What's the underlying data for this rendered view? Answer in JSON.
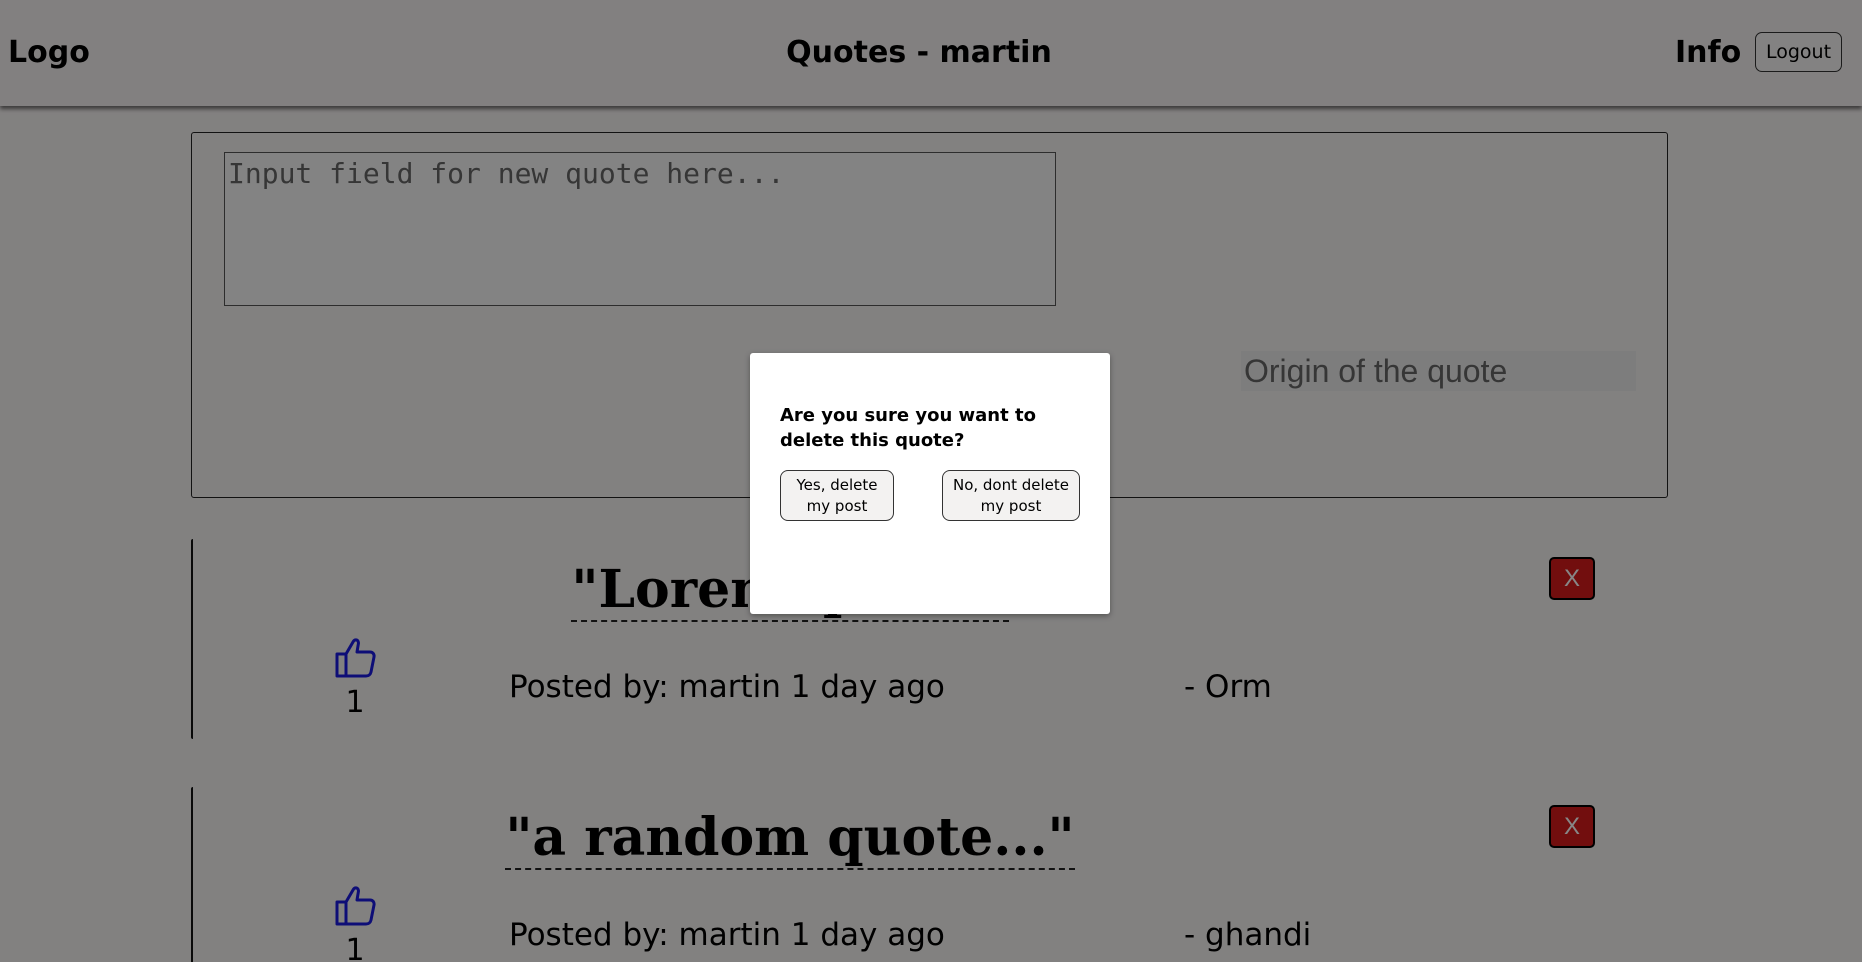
{
  "header": {
    "logo": "Logo",
    "title": "Quotes - martin",
    "info": "Info",
    "logout": "Logout"
  },
  "new_quote": {
    "quote_placeholder": "Input field for new quote here...",
    "origin_placeholder": "Origin of the quote"
  },
  "quotes": [
    {
      "text": "\"Lorem ipsum\"",
      "likes": "1",
      "posted": "Posted by: martin 1 day ago",
      "origin": "- Orm",
      "delete": "X"
    },
    {
      "text": "\"a random quote...\"",
      "likes": "1",
      "posted": "Posted by: martin 1 day ago",
      "origin": "- ghandi",
      "delete": "X"
    }
  ],
  "modal": {
    "question": "Are you sure you want to delete this quote?",
    "yes": "Yes, delete my post",
    "no": "No, dont delete my post"
  },
  "colors": {
    "delete_button": "#d81c1c",
    "thumb_icon": "#1c1ce0",
    "overlay": "rgba(0,0,0,0.47)"
  }
}
